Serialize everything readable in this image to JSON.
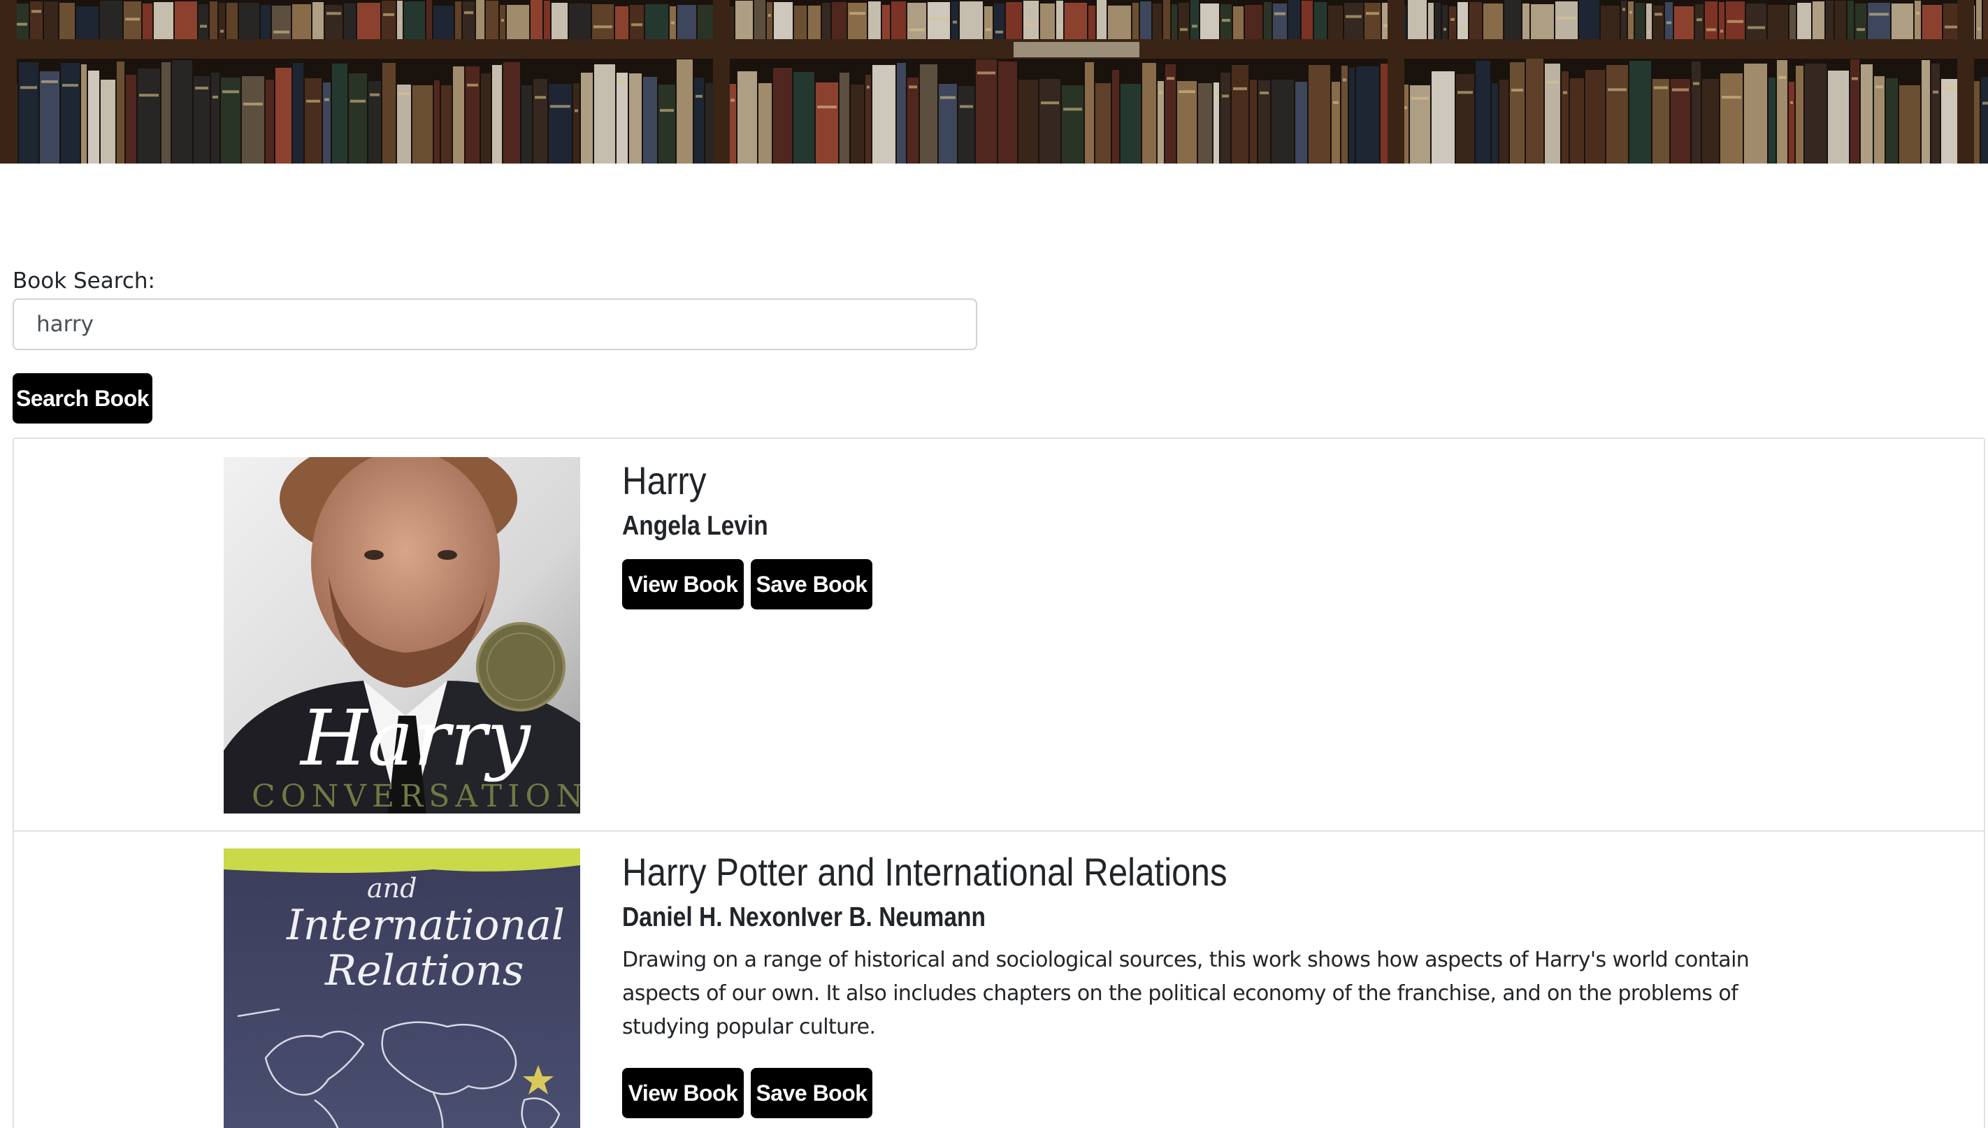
{
  "search": {
    "label": "Book Search:",
    "value": "harry",
    "button_label": "Search Book"
  },
  "results": [
    {
      "title": "Harry",
      "author": "Angela Levin",
      "description": "",
      "cover_text": "Harry",
      "cover_subtext": "CONVERSATIONS",
      "view_label": "View Book",
      "save_label": "Save Book"
    },
    {
      "title": "Harry Potter and International Relations",
      "author": "Daniel H. NexonIver B. Neumann",
      "description": "Drawing on a range of historical and sociological sources, this work shows how aspects of Harry's world contain aspects of our own. It also includes chapters on the political economy of the franchise, and on the problems of studying popular culture.",
      "cover_top_text": "and",
      "cover_text_line1": "International",
      "cover_text_line2": "Relations",
      "view_label": "View Book",
      "save_label": "Save Book"
    }
  ],
  "colors": {
    "button_bg": "#000000",
    "button_text": "#ffffff",
    "border": "#dee2e6",
    "shelf_wood": "#3a2416"
  }
}
